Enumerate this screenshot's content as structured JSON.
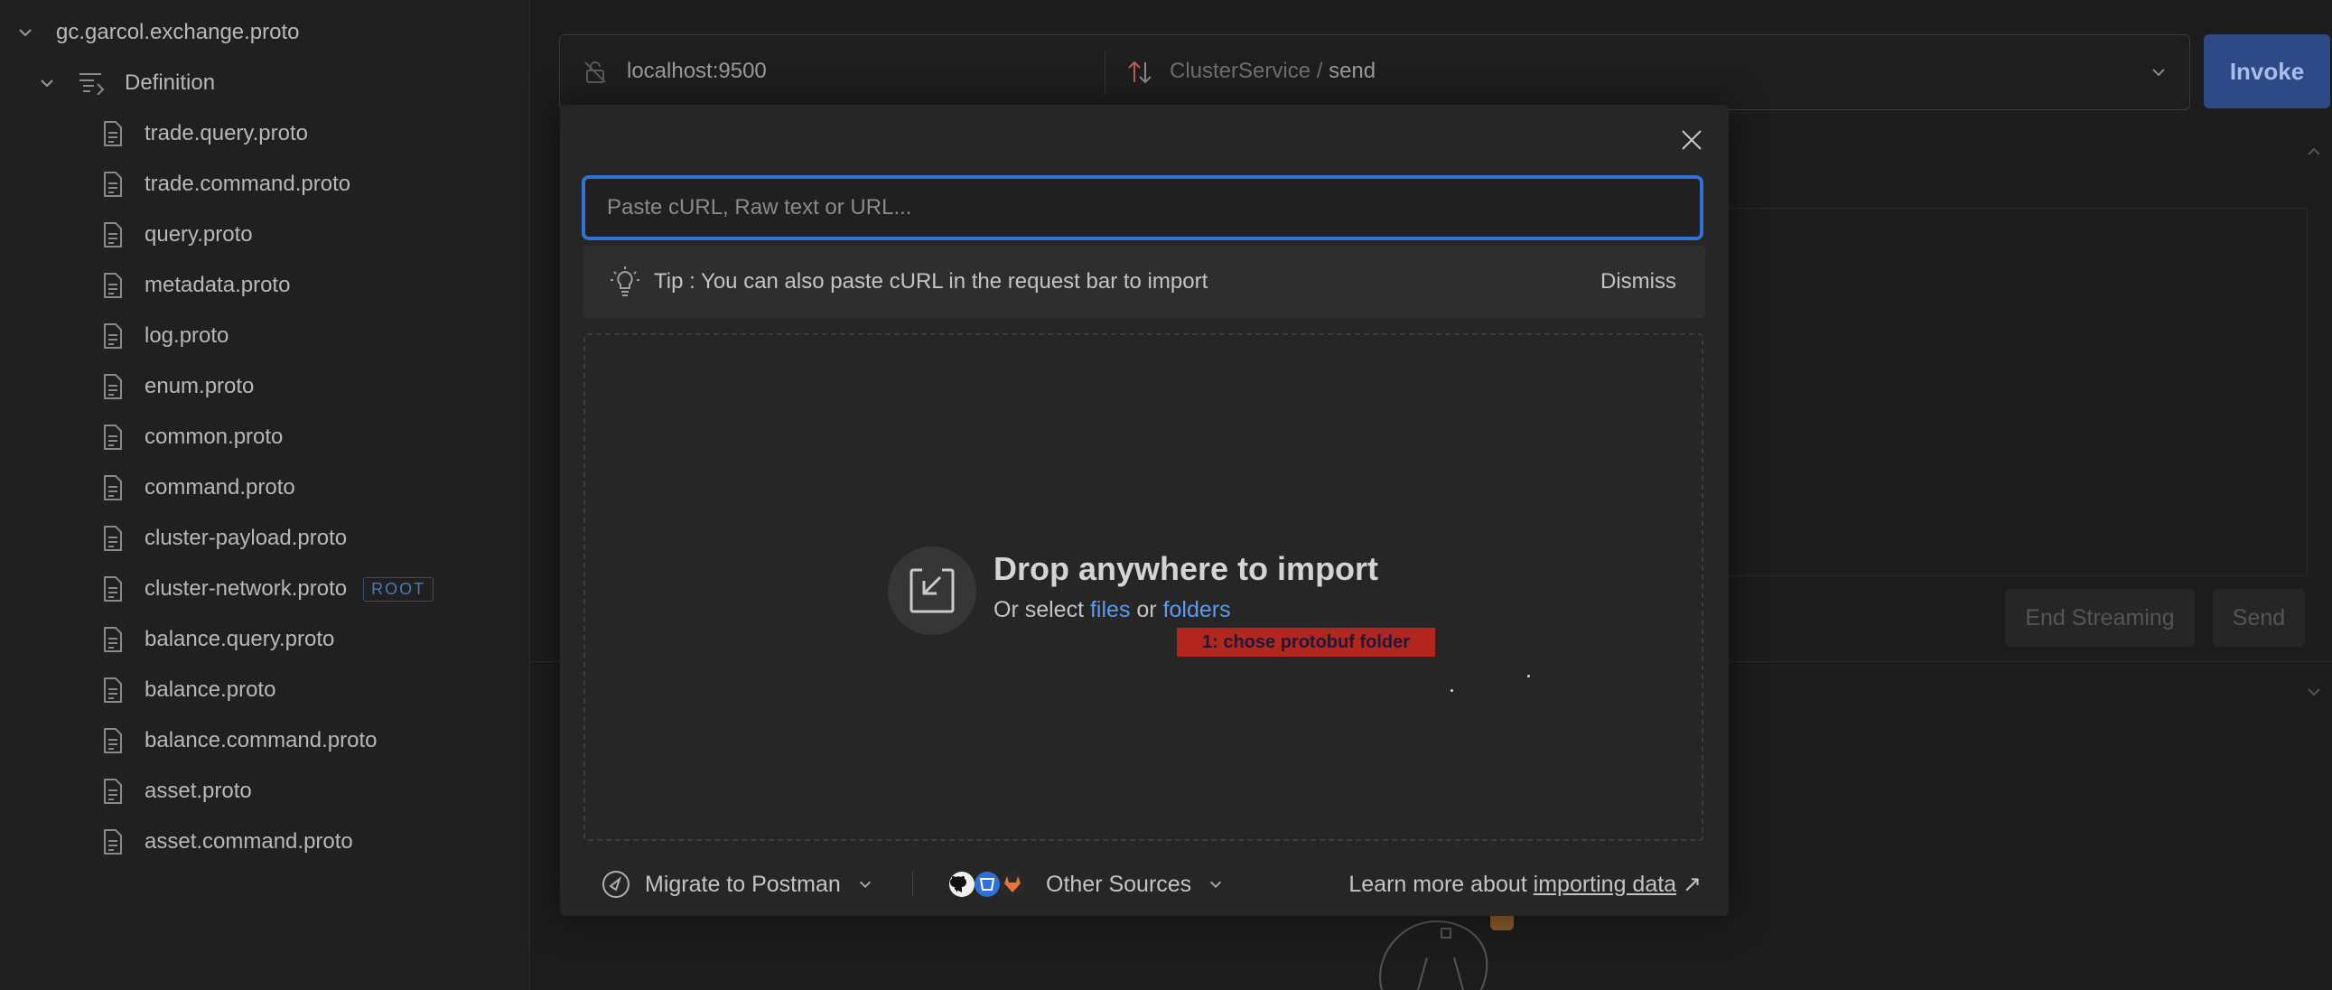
{
  "sidebar": {
    "root": "gc.garcol.exchange.proto",
    "definition": "Definition",
    "files": [
      {
        "name": "trade.query.proto"
      },
      {
        "name": "trade.command.proto"
      },
      {
        "name": "query.proto"
      },
      {
        "name": "metadata.proto"
      },
      {
        "name": "log.proto"
      },
      {
        "name": "enum.proto"
      },
      {
        "name": "common.proto"
      },
      {
        "name": "command.proto"
      },
      {
        "name": "cluster-payload.proto"
      },
      {
        "name": "cluster-network.proto",
        "badge": "ROOT"
      },
      {
        "name": "balance.query.proto"
      },
      {
        "name": "balance.proto"
      },
      {
        "name": "balance.command.proto"
      },
      {
        "name": "asset.proto"
      },
      {
        "name": "asset.command.proto"
      }
    ]
  },
  "request": {
    "url": "localhost:9500",
    "service": "ClusterService",
    "separator": " / ",
    "method": "send",
    "invoke": "Invoke"
  },
  "streaming": {
    "end": "End Streaming",
    "send": "Send"
  },
  "modal": {
    "paste_placeholder": "Paste cURL, Raw text or URL...",
    "tip": "Tip : You can also paste cURL in the request bar to import",
    "dismiss": "Dismiss",
    "drop_title": "Drop anywhere to import",
    "or_select": "Or select ",
    "files": "files",
    "or": " or ",
    "folders": "folders",
    "annotation": "1: chose protobuf folder",
    "migrate": "Migrate to Postman",
    "other_sources": "Other Sources",
    "learn_more": "Learn more about ",
    "importing_data": "importing data",
    "arrow": "↗"
  },
  "colors": {
    "accent": "#2f73d6",
    "link": "#5b9bf0",
    "annotation_bg": "#b3261e"
  }
}
